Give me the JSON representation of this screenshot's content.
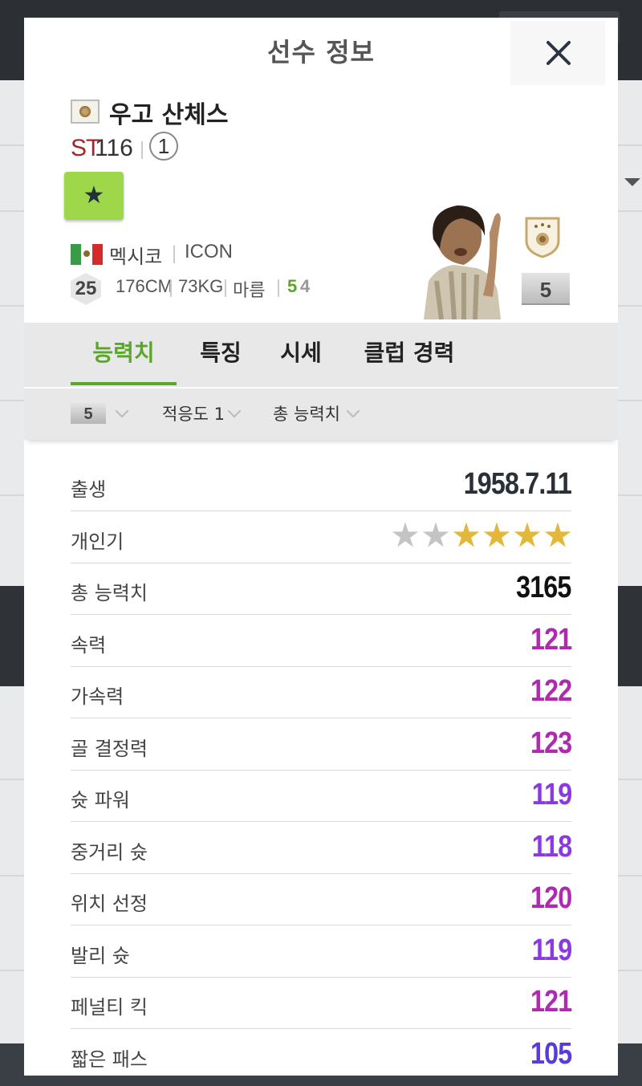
{
  "modal": {
    "title": "선수 정보",
    "close_label": "✕"
  },
  "player": {
    "name": "우고 산체스",
    "position": "ST",
    "overall": "116",
    "rank": "1",
    "nation": "멕시코",
    "season": "ICON",
    "age": "25",
    "height": "176CM",
    "weight": "73KG",
    "build": "마름",
    "foot_left": "5",
    "foot_right": "4",
    "grade": "5"
  },
  "colors": {
    "accent_green": "#5aa62a",
    "favorite_green": "#9ed84a",
    "position_red": "#a3262a",
    "star_gold": "#e3b83a",
    "star_grey": "#c4c4c4"
  },
  "tabs": [
    {
      "label": "능력치",
      "active": true
    },
    {
      "label": "특징",
      "active": false
    },
    {
      "label": "시세",
      "active": false
    },
    {
      "label": "클럽 경력",
      "active": false
    }
  ],
  "filters": {
    "grade": "5",
    "adaptation": "적응도 1",
    "sort": "총 능력치"
  },
  "info_rows": {
    "birth": {
      "label": "출생",
      "value": "1958.7.11"
    },
    "skill_moves": {
      "label": "개인기",
      "stars_total": 6,
      "stars_filled": 4
    },
    "total": {
      "label": "총 능력치",
      "value": "3165"
    }
  },
  "stats": [
    {
      "label": "속력",
      "value": "121",
      "color": "#b02ab0"
    },
    {
      "label": "가속력",
      "value": "122",
      "color": "#b02ab0"
    },
    {
      "label": "골 결정력",
      "value": "123",
      "color": "#b02ab0"
    },
    {
      "label": "슛 파워",
      "value": "119",
      "color": "#8a3ae0"
    },
    {
      "label": "중거리 슛",
      "value": "118",
      "color": "#8a3ae0"
    },
    {
      "label": "위치 선정",
      "value": "120",
      "color": "#b02ab0"
    },
    {
      "label": "발리 슛",
      "value": "119",
      "color": "#8a3ae0"
    },
    {
      "label": "페널티 킥",
      "value": "121",
      "color": "#b02ab0"
    },
    {
      "label": "짧은 패스",
      "value": "105",
      "color": "#5a3ad8"
    }
  ]
}
